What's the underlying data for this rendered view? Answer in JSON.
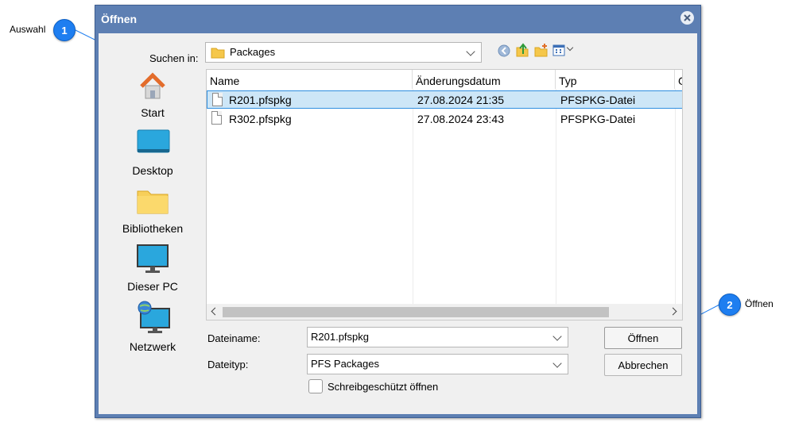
{
  "callouts": [
    {
      "number": "1",
      "label": "Auswahl"
    },
    {
      "number": "2",
      "label": "Öffnen"
    }
  ],
  "dialog": {
    "title": "Öffnen",
    "look_in_label": "Suchen in:",
    "look_in_value": "Packages",
    "places": [
      "Start",
      "Desktop",
      "Bibliotheken",
      "Dieser PC",
      "Netzwerk"
    ],
    "columns": [
      "Name",
      "Änderungsdatum",
      "Typ",
      "G"
    ],
    "files": [
      {
        "name": "R201.pfspkg",
        "modified": "27.08.2024 21:35",
        "type": "PFSPKG-Datei",
        "selected": true
      },
      {
        "name": "R302.pfspkg",
        "modified": "27.08.2024 23:43",
        "type": "PFSPKG-Datei",
        "selected": false
      }
    ],
    "filename_label": "Dateiname:",
    "filename_value": "R201.pfspkg",
    "filetype_label": "Dateityp:",
    "filetype_value": "PFS Packages",
    "readonly_label": "Schreibgeschützt öffnen",
    "open_button": "Öffnen",
    "cancel_button": "Abbrechen"
  },
  "colors": {
    "title_bar": "#5d7fb3",
    "selection": "#cde6f7",
    "callout": "#1e7ef0"
  }
}
